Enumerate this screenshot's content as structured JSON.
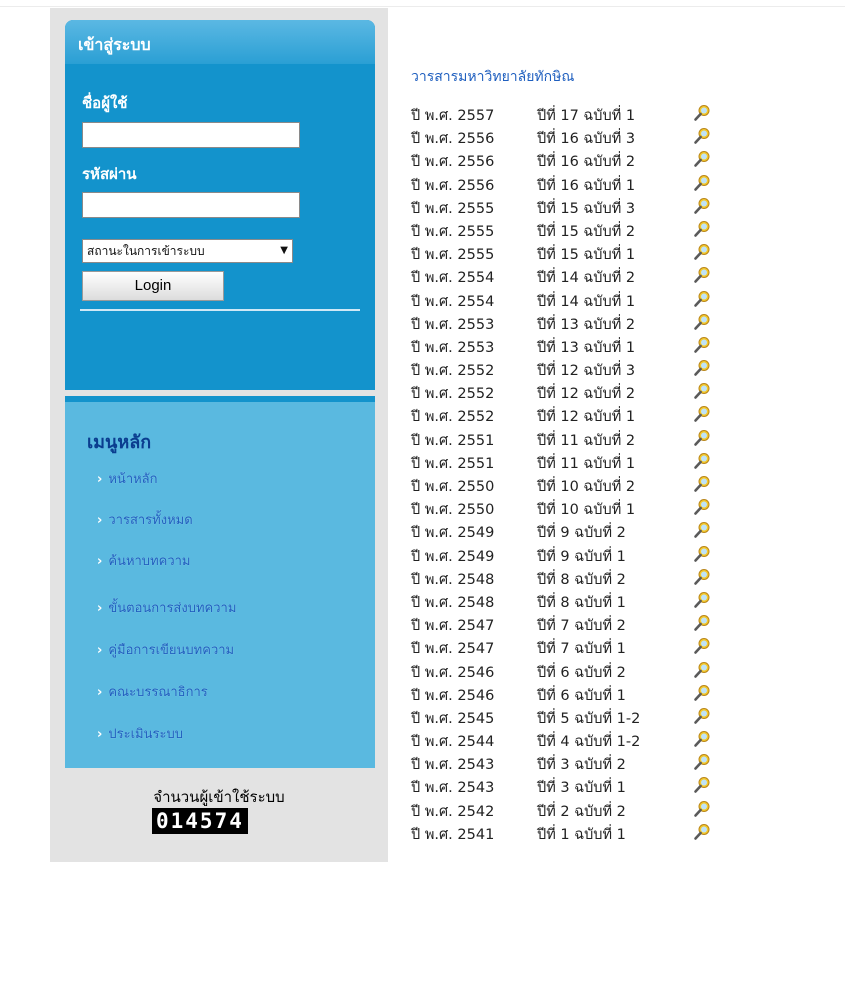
{
  "login": {
    "title": "เข้าสู่ระบบ",
    "username_label": "ชื่อผู้ใช้",
    "username_value": "",
    "password_label": "รหัสผ่าน",
    "password_value": "",
    "status_select": "สถานะในการเข้าระบบ",
    "login_button": "Login"
  },
  "menu": {
    "title": "เมนูหลัก",
    "items": [
      {
        "label": "หน้าหลัก"
      },
      {
        "label": "วารสารทั้งหมด"
      },
      {
        "label": "ค้นหาบทความ"
      },
      {
        "label": "ขั้นตอนการส่งบทความ"
      },
      {
        "label": "คู่มือการเขียนบทความ"
      },
      {
        "label": "คณะบรรณาธิการ"
      },
      {
        "label": "ประเมินระบบ"
      }
    ]
  },
  "counter": {
    "label": "จำนวนผู้เข้าใช้ระบบ",
    "value": "014574"
  },
  "journal": {
    "title": "วารสารมหาวิทยาลัยทักษิณ",
    "issue_icon": "search-magnifier-icon",
    "issues": [
      {
        "year": "ปี พ.ศ. 2557",
        "volume": "ปีที่ 17 ฉบับที่ 1"
      },
      {
        "year": "ปี พ.ศ. 2556",
        "volume": "ปีที่ 16 ฉบับที่ 3"
      },
      {
        "year": "ปี พ.ศ. 2556",
        "volume": "ปีที่ 16 ฉบับที่ 2"
      },
      {
        "year": "ปี พ.ศ. 2556",
        "volume": "ปีที่ 16 ฉบับที่ 1"
      },
      {
        "year": "ปี พ.ศ. 2555",
        "volume": "ปีที่ 15 ฉบับที่ 3"
      },
      {
        "year": "ปี พ.ศ. 2555",
        "volume": "ปีที่ 15 ฉบับที่ 2"
      },
      {
        "year": "ปี พ.ศ. 2555",
        "volume": "ปีที่ 15 ฉบับที่ 1"
      },
      {
        "year": "ปี พ.ศ. 2554",
        "volume": "ปีที่ 14 ฉบับที่ 2"
      },
      {
        "year": "ปี พ.ศ. 2554",
        "volume": "ปีที่ 14 ฉบับที่ 1"
      },
      {
        "year": "ปี พ.ศ. 2553",
        "volume": "ปีที่ 13 ฉบับที่ 2"
      },
      {
        "year": "ปี พ.ศ. 2553",
        "volume": "ปีที่ 13 ฉบับที่ 1"
      },
      {
        "year": "ปี พ.ศ. 2552",
        "volume": "ปีที่ 12 ฉบับที่ 3"
      },
      {
        "year": "ปี พ.ศ. 2552",
        "volume": "ปีที่ 12 ฉบับที่ 2"
      },
      {
        "year": "ปี พ.ศ. 2552",
        "volume": "ปีที่ 12 ฉบับที่ 1"
      },
      {
        "year": "ปี พ.ศ. 2551",
        "volume": "ปีที่ 11 ฉบับที่ 2"
      },
      {
        "year": "ปี พ.ศ. 2551",
        "volume": "ปีที่ 11 ฉบับที่ 1"
      },
      {
        "year": "ปี พ.ศ. 2550",
        "volume": "ปีที่ 10 ฉบับที่ 2"
      },
      {
        "year": "ปี พ.ศ. 2550",
        "volume": "ปีที่ 10 ฉบับที่ 1"
      },
      {
        "year": "ปี พ.ศ. 2549",
        "volume": "ปีที่ 9 ฉบับที่ 2"
      },
      {
        "year": "ปี พ.ศ. 2549",
        "volume": "ปีที่ 9 ฉบับที่ 1"
      },
      {
        "year": "ปี พ.ศ. 2548",
        "volume": "ปีที่ 8 ฉบับที่ 2"
      },
      {
        "year": "ปี พ.ศ. 2548",
        "volume": "ปีที่ 8 ฉบับที่ 1"
      },
      {
        "year": "ปี พ.ศ. 2547",
        "volume": "ปีที่ 7 ฉบับที่ 2"
      },
      {
        "year": "ปี พ.ศ. 2547",
        "volume": "ปีที่ 7 ฉบับที่ 1"
      },
      {
        "year": "ปี พ.ศ. 2546",
        "volume": "ปีที่ 6 ฉบับที่ 2"
      },
      {
        "year": "ปี พ.ศ. 2546",
        "volume": "ปีที่ 6 ฉบับที่ 1"
      },
      {
        "year": "ปี พ.ศ. 2545",
        "volume": "ปีที่ 5 ฉบับที่ 1-2"
      },
      {
        "year": "ปี พ.ศ. 2544",
        "volume": "ปีที่ 4 ฉบับที่ 1-2"
      },
      {
        "year": "ปี พ.ศ. 2543",
        "volume": "ปีที่ 3 ฉบับที่ 2"
      },
      {
        "year": "ปี พ.ศ. 2543",
        "volume": "ปีที่ 3 ฉบับที่ 1"
      },
      {
        "year": "ปี พ.ศ. 2542",
        "volume": "ปีที่ 2 ฉบับที่ 2"
      },
      {
        "year": "ปี พ.ศ. 2541",
        "volume": "ปีที่ 1 ฉบับที่ 1"
      }
    ]
  }
}
